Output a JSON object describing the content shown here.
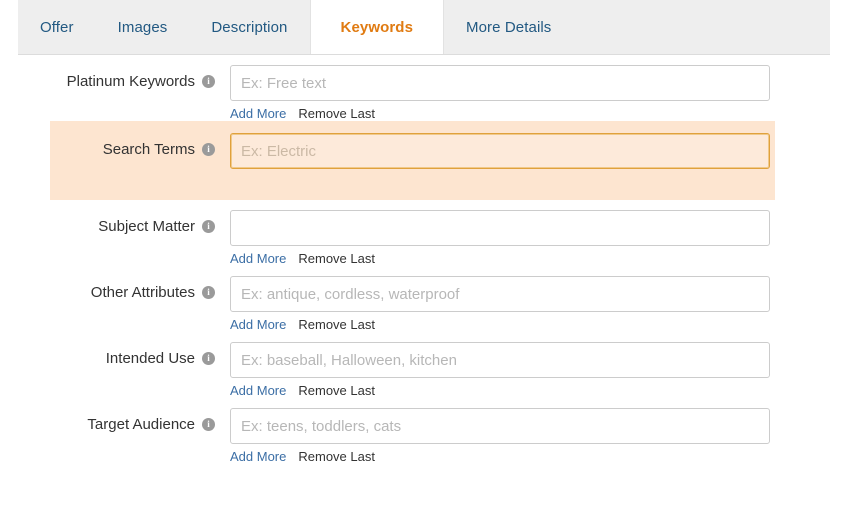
{
  "tabs": [
    {
      "label": "Offer",
      "active": false
    },
    {
      "label": "Images",
      "active": false
    },
    {
      "label": "Description",
      "active": false
    },
    {
      "label": "Keywords",
      "active": true
    },
    {
      "label": "More Details",
      "active": false
    }
  ],
  "colors": {
    "tabbar_bg": "#eeeeee",
    "tab_text": "#225982",
    "active_tab_text": "#e07b12",
    "active_tab_bg": "#ffffff",
    "highlight_row_bg": "#fde5d0",
    "focused_input_border": "#e0a13c",
    "link_blue": "#3b6ea5",
    "placeholder_gray": "#b7b7b7",
    "info_icon_bg": "#9a9a9a"
  },
  "links": {
    "add_more": "Add More",
    "remove_last": "Remove Last"
  },
  "info_icon_glyph": "i",
  "fields": [
    {
      "label": "Platinum Keywords",
      "placeholder": "Ex: Free text",
      "value": "",
      "focused": false,
      "highlighted": false,
      "has_links": true,
      "icon": "info-icon"
    },
    {
      "label": "Search Terms",
      "placeholder": "Ex: Electric",
      "value": "",
      "focused": true,
      "highlighted": true,
      "has_links": false,
      "icon": "info-icon"
    },
    {
      "label": "Subject Matter",
      "placeholder": "",
      "value": "",
      "focused": false,
      "highlighted": false,
      "has_links": true,
      "icon": "info-icon"
    },
    {
      "label": "Other Attributes",
      "placeholder": "Ex: antique, cordless, waterproof",
      "value": "",
      "focused": false,
      "highlighted": false,
      "has_links": true,
      "icon": "info-icon"
    },
    {
      "label": "Intended Use",
      "placeholder": "Ex: baseball, Halloween, kitchen",
      "value": "",
      "focused": false,
      "highlighted": false,
      "has_links": true,
      "icon": "info-icon"
    },
    {
      "label": "Target Audience",
      "placeholder": "Ex: teens, toddlers, cats",
      "value": "",
      "focused": false,
      "highlighted": false,
      "has_links": true,
      "icon": "info-icon"
    }
  ]
}
